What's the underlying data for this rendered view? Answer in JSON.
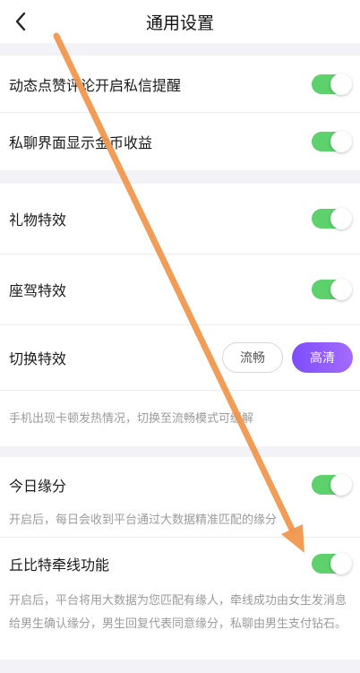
{
  "header": {
    "title": "通用设置",
    "back_icon": "chevron-left-icon"
  },
  "colors": {
    "toggle_on": "#5dd16c",
    "hd_gradient_start": "#7d4dfb",
    "hd_gradient_end": "#a56bff",
    "annotation_arrow": "#f0954a"
  },
  "section_messages": {
    "rows": [
      {
        "label": "动态点赞评论开启私信提醒",
        "toggle": true
      },
      {
        "label": "私聊界面显示金币收益",
        "toggle": true
      }
    ]
  },
  "section_effects": {
    "rows": [
      {
        "label": "礼物特效",
        "toggle": true
      },
      {
        "label": "座驾特效",
        "toggle": true
      }
    ],
    "switch_label": "切换特效",
    "mode_options": [
      "流畅",
      "高清"
    ],
    "mode_selected": "高清",
    "hint": "手机出现卡顿发热情况，切换至流畅模式可缓解"
  },
  "section_match": {
    "today_label": "今日缘分",
    "today_toggle": true,
    "today_hint": "开启后，每日会收到平台通过大数据精准匹配的缘分",
    "cupid_label": "丘比特牵线功能",
    "cupid_toggle": true,
    "cupid_hint": "开启后，平台将用大数据为您匹配有缘人，牵线成功由女生发消息给男生确认缘分，男生回复代表同意缘分，私聊由男生支付钻石。"
  }
}
